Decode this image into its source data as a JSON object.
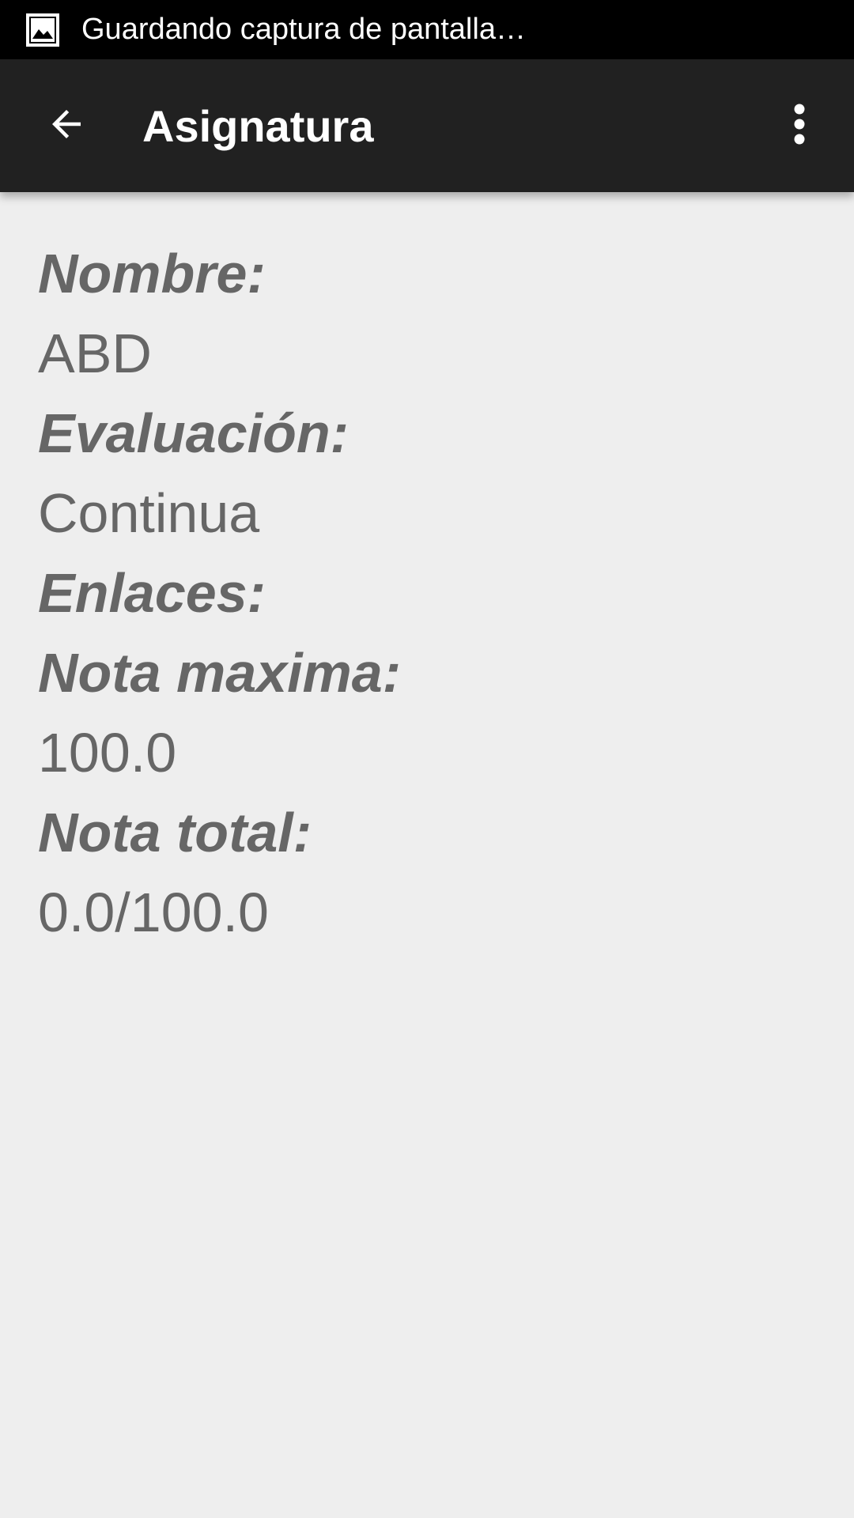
{
  "status_bar": {
    "icon": "screenshot-image-icon",
    "text": "Guardando captura de pantalla…"
  },
  "app_bar": {
    "back_icon": "arrow-back-icon",
    "title": "Asignatura",
    "menu_icon": "more-vert-icon"
  },
  "details": {
    "nombre_label": "Nombre:",
    "nombre_value": "ABD",
    "evaluacion_label": "Evaluación:",
    "evaluacion_value": "Continua",
    "enlaces_label": "Enlaces:",
    "nota_maxima_label": "Nota maxima:",
    "nota_maxima_value": "100.0",
    "nota_total_label": "Nota total:",
    "nota_total_value": "0.0/100.0"
  },
  "colors": {
    "status_bar_bg": "#000000",
    "app_bar_bg": "#212121",
    "page_bg": "#eeeeee",
    "text_gray": "#666666"
  }
}
